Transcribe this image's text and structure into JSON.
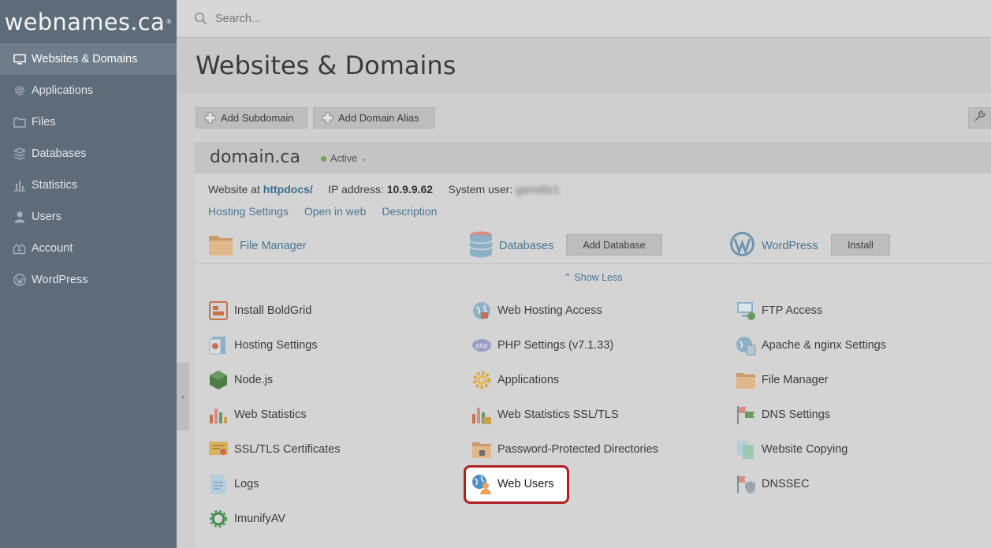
{
  "brand": {
    "logo_text": "webnames.ca",
    "logo_mark": "®"
  },
  "sidebar": {
    "items": [
      {
        "label": "Websites & Domains",
        "icon": "monitor-icon",
        "active": true
      },
      {
        "label": "Applications",
        "icon": "gear-icon"
      },
      {
        "label": "Files",
        "icon": "folder-icon"
      },
      {
        "label": "Databases",
        "icon": "database-icon"
      },
      {
        "label": "Statistics",
        "icon": "bar-chart-icon"
      },
      {
        "label": "Users",
        "icon": "user-icon"
      },
      {
        "label": "Account",
        "icon": "account-icon"
      },
      {
        "label": "WordPress",
        "icon": "wordpress-icon"
      }
    ],
    "collapse_glyph": "‹"
  },
  "search": {
    "placeholder": "Search..."
  },
  "page": {
    "title": "Websites & Domains"
  },
  "toolbar": {
    "add_subdomain": "Add Subdomain",
    "add_domain_alias": "Add Domain Alias"
  },
  "domain": {
    "name": "domain.ca",
    "status": "Active",
    "website_at_label": "Website at",
    "website_path": "httpdocs/",
    "ip_label": "IP address:",
    "ip_value": "10.9.9.62",
    "system_user_label": "System user:",
    "system_user_value": "garrettx1",
    "links": [
      "Hosting Settings",
      "Open in web",
      "Description"
    ],
    "quick": {
      "file_manager": "File Manager",
      "databases": "Databases",
      "add_database": "Add Database",
      "wordpress": "WordPress",
      "install": "Install"
    },
    "show_less": "Show Less",
    "tools": {
      "col1": [
        "Install BoldGrid",
        "Hosting Settings",
        "Node.js",
        "Web Statistics",
        "SSL/TLS Certificates",
        "Logs",
        "ImunifyAV"
      ],
      "col2": [
        "Web Hosting Access",
        "PHP Settings (v7.1.33)",
        "Applications",
        "Web Statistics SSL/TLS",
        "Password-Protected Directories",
        "Web Users"
      ],
      "col3": [
        "FTP Access",
        "Apache & nginx Settings",
        "File Manager",
        "DNS Settings",
        "Website Copying",
        "DNSSEC"
      ]
    }
  },
  "colors": {
    "sidebar_bg": "#5e6b79",
    "link": "#4a7694",
    "highlight_border": "#b01e23",
    "status_dot": "#71a052"
  }
}
